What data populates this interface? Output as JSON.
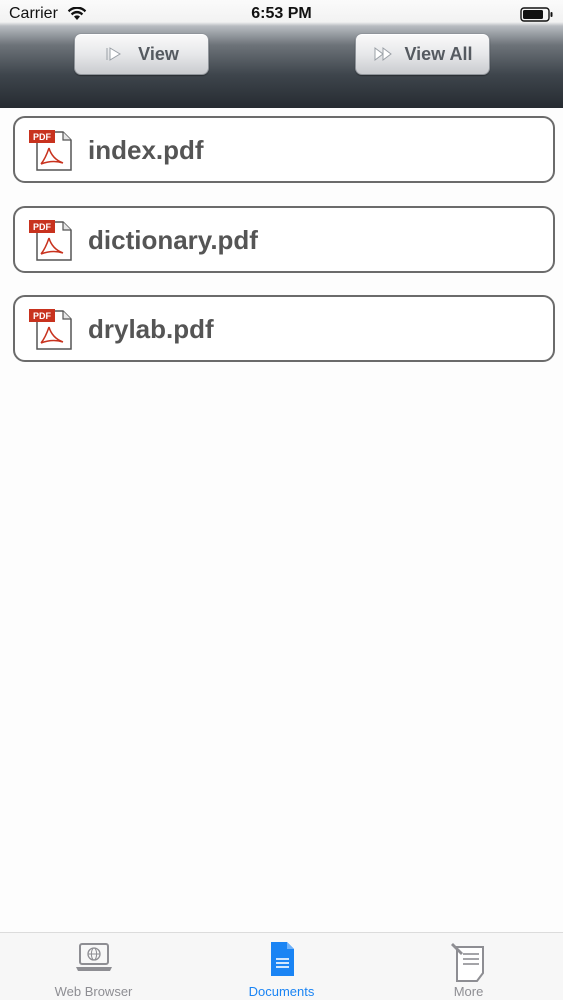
{
  "status_bar": {
    "carrier": "Carrier",
    "time": "6:53 PM",
    "wifi_icon": "wifi-icon",
    "battery_icon": "battery-icon"
  },
  "toolbar": {
    "view_label": "View",
    "view_icon": "play-icon",
    "view_all_label": "View All",
    "view_all_icon": "fast-forward-icon"
  },
  "files": [
    {
      "name": "index.pdf",
      "icon": "pdf-file-icon"
    },
    {
      "name": "dictionary.pdf",
      "icon": "pdf-file-icon"
    },
    {
      "name": "drylab.pdf",
      "icon": "pdf-file-icon"
    }
  ],
  "tab_bar": {
    "tabs": [
      {
        "label": "Web Browser",
        "icon": "laptop-globe-icon",
        "active": false
      },
      {
        "label": "Documents",
        "icon": "document-icon",
        "active": true
      },
      {
        "label": "More",
        "icon": "notepad-pencil-icon",
        "active": false
      }
    ]
  },
  "colors": {
    "accent": "#1a84f4",
    "inactive_tab": "#8e8e93",
    "file_text": "#555555",
    "pdf_red": "#c8321e"
  }
}
